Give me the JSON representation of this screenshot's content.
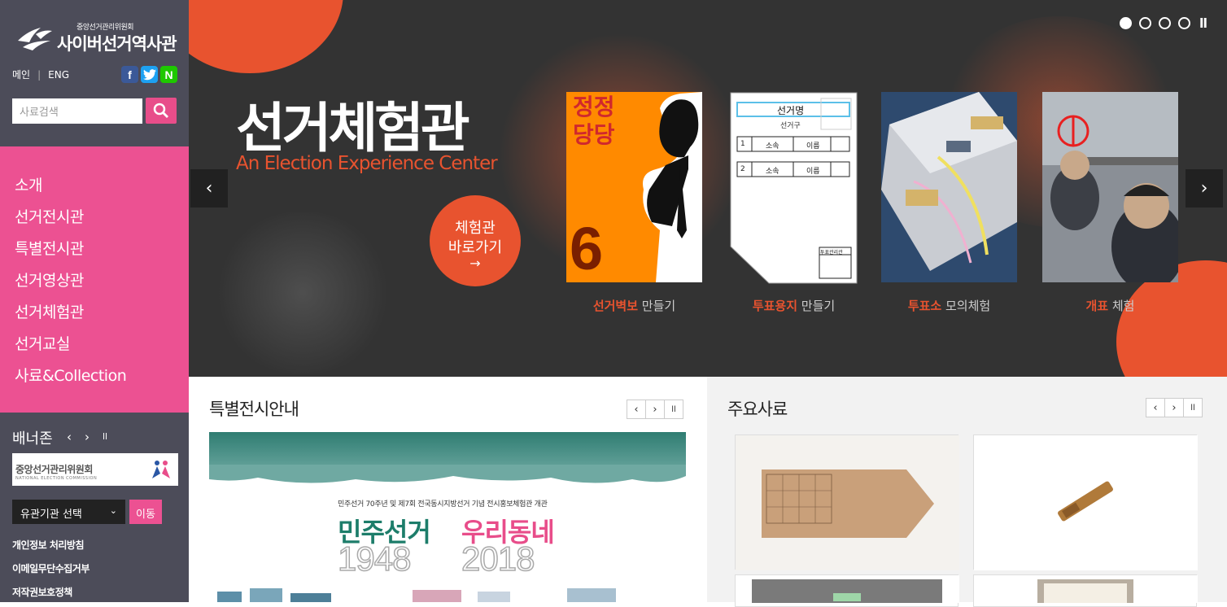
{
  "brand": {
    "sub": "중앙선거관리위원회",
    "name": "사이버선거역사관"
  },
  "util": {
    "main": "메인",
    "eng": "ENG"
  },
  "sns": {
    "facebook": "f",
    "twitter": "t",
    "naver": "N"
  },
  "search": {
    "placeholder": "사료검색"
  },
  "nav": {
    "items": [
      "소개",
      "선거전시관",
      "특별전시관",
      "선거영상관",
      "선거체험관",
      "선거교실",
      "사료&Collection"
    ]
  },
  "bannerzone": {
    "title": "배너존",
    "prev": "‹",
    "next": "›",
    "pause": "ll"
  },
  "org_banner": {
    "name": "중앙선거관리위원회",
    "name_en": "NATIONAL ELECTION COMMISSION"
  },
  "related": {
    "selected": "유관기관 선택",
    "go": "이동"
  },
  "footer_links": [
    "개인정보 처리방침",
    "이메일무단수집거부",
    "저작권보호정책"
  ],
  "hero": {
    "title": "선거체험관",
    "subtitle": "An Election Experience Center",
    "button_l1": "체험관",
    "button_l2": "바로가기",
    "button_arrow": "→",
    "cards": [
      {
        "highlight": "선거벽보",
        "rest": " 만들기"
      },
      {
        "highlight": "투표용지",
        "rest": " 만들기"
      },
      {
        "highlight": "투표소",
        "rest": " 모의체험"
      },
      {
        "highlight": "개표",
        "rest": " 체험"
      }
    ],
    "poster_card": {
      "l1": "정정",
      "l2": "당당",
      "num": "6"
    },
    "ballot_card": {
      "title": "선거명",
      "district": "선거구",
      "stamp": "투표관리관",
      "rows": [
        {
          "no": "1",
          "party": "소속",
          "name": "이름"
        },
        {
          "no": "2",
          "party": "소속",
          "name": "이름"
        }
      ]
    },
    "prev": "‹",
    "next": "›",
    "pause": "ll"
  },
  "special": {
    "title": "특별전시안내",
    "prev": "‹",
    "next": "›",
    "pause": "ll",
    "poster": {
      "line1": "민주선거 70주년 및 제7회 전국동시지방선거 기념 전시홍보체험관 개관",
      "left": "민주선거",
      "right": "우리동네",
      "y1": "1948",
      "y2": "2018"
    }
  },
  "main_items": {
    "title": "주요사료",
    "prev": "‹",
    "next": "›",
    "pause": "ll"
  },
  "colors": {
    "pink": "#ec5192",
    "orange": "#e8532f",
    "sidebar": "#4c4c59"
  }
}
